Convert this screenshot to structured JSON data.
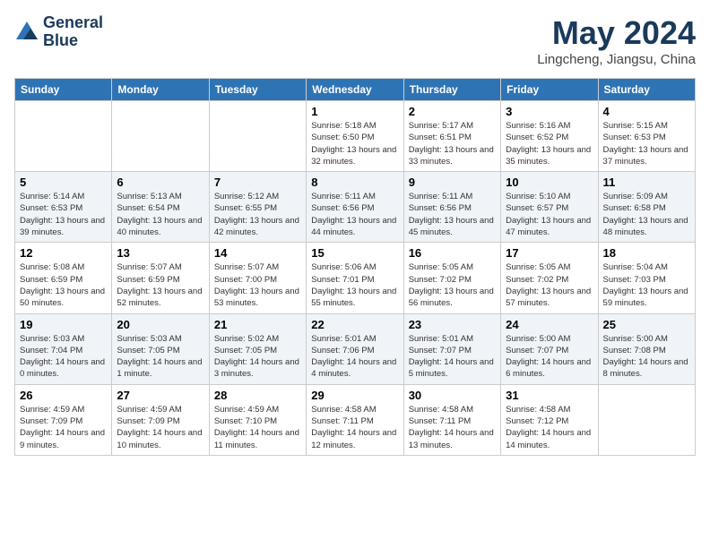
{
  "header": {
    "logo_line1": "General",
    "logo_line2": "Blue",
    "title": "May 2024",
    "subtitle": "Lingcheng, Jiangsu, China"
  },
  "days_of_week": [
    "Sunday",
    "Monday",
    "Tuesday",
    "Wednesday",
    "Thursday",
    "Friday",
    "Saturday"
  ],
  "weeks": [
    [
      {
        "date": "",
        "info": ""
      },
      {
        "date": "",
        "info": ""
      },
      {
        "date": "",
        "info": ""
      },
      {
        "date": "1",
        "info": "Sunrise: 5:18 AM\nSunset: 6:50 PM\nDaylight: 13 hours and 32 minutes."
      },
      {
        "date": "2",
        "info": "Sunrise: 5:17 AM\nSunset: 6:51 PM\nDaylight: 13 hours and 33 minutes."
      },
      {
        "date": "3",
        "info": "Sunrise: 5:16 AM\nSunset: 6:52 PM\nDaylight: 13 hours and 35 minutes."
      },
      {
        "date": "4",
        "info": "Sunrise: 5:15 AM\nSunset: 6:53 PM\nDaylight: 13 hours and 37 minutes."
      }
    ],
    [
      {
        "date": "5",
        "info": "Sunrise: 5:14 AM\nSunset: 6:53 PM\nDaylight: 13 hours and 39 minutes."
      },
      {
        "date": "6",
        "info": "Sunrise: 5:13 AM\nSunset: 6:54 PM\nDaylight: 13 hours and 40 minutes."
      },
      {
        "date": "7",
        "info": "Sunrise: 5:12 AM\nSunset: 6:55 PM\nDaylight: 13 hours and 42 minutes."
      },
      {
        "date": "8",
        "info": "Sunrise: 5:11 AM\nSunset: 6:56 PM\nDaylight: 13 hours and 44 minutes."
      },
      {
        "date": "9",
        "info": "Sunrise: 5:11 AM\nSunset: 6:56 PM\nDaylight: 13 hours and 45 minutes."
      },
      {
        "date": "10",
        "info": "Sunrise: 5:10 AM\nSunset: 6:57 PM\nDaylight: 13 hours and 47 minutes."
      },
      {
        "date": "11",
        "info": "Sunrise: 5:09 AM\nSunset: 6:58 PM\nDaylight: 13 hours and 48 minutes."
      }
    ],
    [
      {
        "date": "12",
        "info": "Sunrise: 5:08 AM\nSunset: 6:59 PM\nDaylight: 13 hours and 50 minutes."
      },
      {
        "date": "13",
        "info": "Sunrise: 5:07 AM\nSunset: 6:59 PM\nDaylight: 13 hours and 52 minutes."
      },
      {
        "date": "14",
        "info": "Sunrise: 5:07 AM\nSunset: 7:00 PM\nDaylight: 13 hours and 53 minutes."
      },
      {
        "date": "15",
        "info": "Sunrise: 5:06 AM\nSunset: 7:01 PM\nDaylight: 13 hours and 55 minutes."
      },
      {
        "date": "16",
        "info": "Sunrise: 5:05 AM\nSunset: 7:02 PM\nDaylight: 13 hours and 56 minutes."
      },
      {
        "date": "17",
        "info": "Sunrise: 5:05 AM\nSunset: 7:02 PM\nDaylight: 13 hours and 57 minutes."
      },
      {
        "date": "18",
        "info": "Sunrise: 5:04 AM\nSunset: 7:03 PM\nDaylight: 13 hours and 59 minutes."
      }
    ],
    [
      {
        "date": "19",
        "info": "Sunrise: 5:03 AM\nSunset: 7:04 PM\nDaylight: 14 hours and 0 minutes."
      },
      {
        "date": "20",
        "info": "Sunrise: 5:03 AM\nSunset: 7:05 PM\nDaylight: 14 hours and 1 minute."
      },
      {
        "date": "21",
        "info": "Sunrise: 5:02 AM\nSunset: 7:05 PM\nDaylight: 14 hours and 3 minutes."
      },
      {
        "date": "22",
        "info": "Sunrise: 5:01 AM\nSunset: 7:06 PM\nDaylight: 14 hours and 4 minutes."
      },
      {
        "date": "23",
        "info": "Sunrise: 5:01 AM\nSunset: 7:07 PM\nDaylight: 14 hours and 5 minutes."
      },
      {
        "date": "24",
        "info": "Sunrise: 5:00 AM\nSunset: 7:07 PM\nDaylight: 14 hours and 6 minutes."
      },
      {
        "date": "25",
        "info": "Sunrise: 5:00 AM\nSunset: 7:08 PM\nDaylight: 14 hours and 8 minutes."
      }
    ],
    [
      {
        "date": "26",
        "info": "Sunrise: 4:59 AM\nSunset: 7:09 PM\nDaylight: 14 hours and 9 minutes."
      },
      {
        "date": "27",
        "info": "Sunrise: 4:59 AM\nSunset: 7:09 PM\nDaylight: 14 hours and 10 minutes."
      },
      {
        "date": "28",
        "info": "Sunrise: 4:59 AM\nSunset: 7:10 PM\nDaylight: 14 hours and 11 minutes."
      },
      {
        "date": "29",
        "info": "Sunrise: 4:58 AM\nSunset: 7:11 PM\nDaylight: 14 hours and 12 minutes."
      },
      {
        "date": "30",
        "info": "Sunrise: 4:58 AM\nSunset: 7:11 PM\nDaylight: 14 hours and 13 minutes."
      },
      {
        "date": "31",
        "info": "Sunrise: 4:58 AM\nSunset: 7:12 PM\nDaylight: 14 hours and 14 minutes."
      },
      {
        "date": "",
        "info": ""
      }
    ]
  ]
}
